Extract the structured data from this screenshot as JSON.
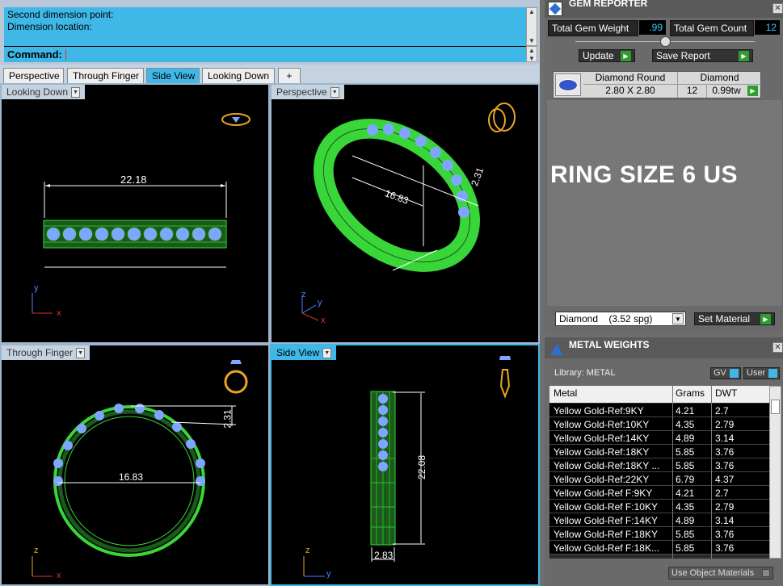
{
  "command": {
    "history": [
      "Second dimension point:",
      "Dimension location:"
    ],
    "prompt_label": "Command:",
    "input_value": ""
  },
  "tabs": [
    {
      "label": "Perspective",
      "active": false
    },
    {
      "label": "Through Finger",
      "active": false
    },
    {
      "label": "Side View",
      "active": true
    },
    {
      "label": "Looking Down",
      "active": false
    },
    {
      "label": "+",
      "active": false
    }
  ],
  "viewports": {
    "looking_down": {
      "label": "Looking Down",
      "dimension": "22.18",
      "axis_x": "x",
      "axis_y": "y"
    },
    "perspective": {
      "label": "Perspective",
      "dimension_a": "16.83",
      "dimension_b": "2.31",
      "axis_x": "x",
      "axis_y": "y",
      "axis_z": "z"
    },
    "through_finger": {
      "label": "Through Finger",
      "dimension_a": "16.83",
      "dimension_b": "2.31",
      "axis_x": "x",
      "axis_z": "z"
    },
    "side_view": {
      "label": "Side View",
      "dimension_a": "22.08",
      "dimension_b": "2.83",
      "axis_y": "y",
      "axis_z": "z"
    }
  },
  "gem_reporter": {
    "title": "GEM REPORTER",
    "total_weight_label": "Total Gem Weight",
    "total_weight_value": ".99",
    "total_count_label": "Total Gem Count",
    "total_count_value": "12",
    "update_label": "Update",
    "save_report_label": "Save Report",
    "gem": {
      "shape_header": "Diamond Round",
      "size": "2.80 X 2.80",
      "material_header": "Diamond",
      "count": "12",
      "weight": "0.99tw"
    },
    "note": "RING SIZE 6 US",
    "material_select": "Diamond    (3.52 spg)",
    "set_material_label": "Set Material"
  },
  "metal_weights": {
    "title": "METAL WEIGHTS",
    "library_label": "Library: METAL",
    "gv_label": "GV",
    "user_label": "User",
    "columns": [
      "Metal",
      "Grams",
      "DWT"
    ],
    "rows": [
      [
        "Yellow Gold-Ref:9KY",
        "4.21",
        "2.7"
      ],
      [
        "Yellow Gold-Ref:10KY",
        "4.35",
        "2.79"
      ],
      [
        "Yellow Gold-Ref:14KY",
        "4.89",
        "3.14"
      ],
      [
        "Yellow Gold-Ref:18KY",
        "5.85",
        "3.76"
      ],
      [
        "Yellow Gold-Ref:18KY ...",
        "5.85",
        "3.76"
      ],
      [
        "Yellow Gold-Ref:22KY",
        "6.79",
        "4.37"
      ],
      [
        "Yellow Gold-Ref F:9KY",
        "4.21",
        "2.7"
      ],
      [
        "Yellow Gold-Ref F:10KY",
        "4.35",
        "2.79"
      ],
      [
        "Yellow Gold-Ref F:14KY",
        "4.89",
        "3.14"
      ],
      [
        "Yellow Gold-Ref F:18KY",
        "5.85",
        "3.76"
      ],
      [
        "Yellow Gold-Ref F:18K...",
        "5.85",
        "3.76"
      ]
    ],
    "use_object_materials_label": "Use Object Materials"
  }
}
